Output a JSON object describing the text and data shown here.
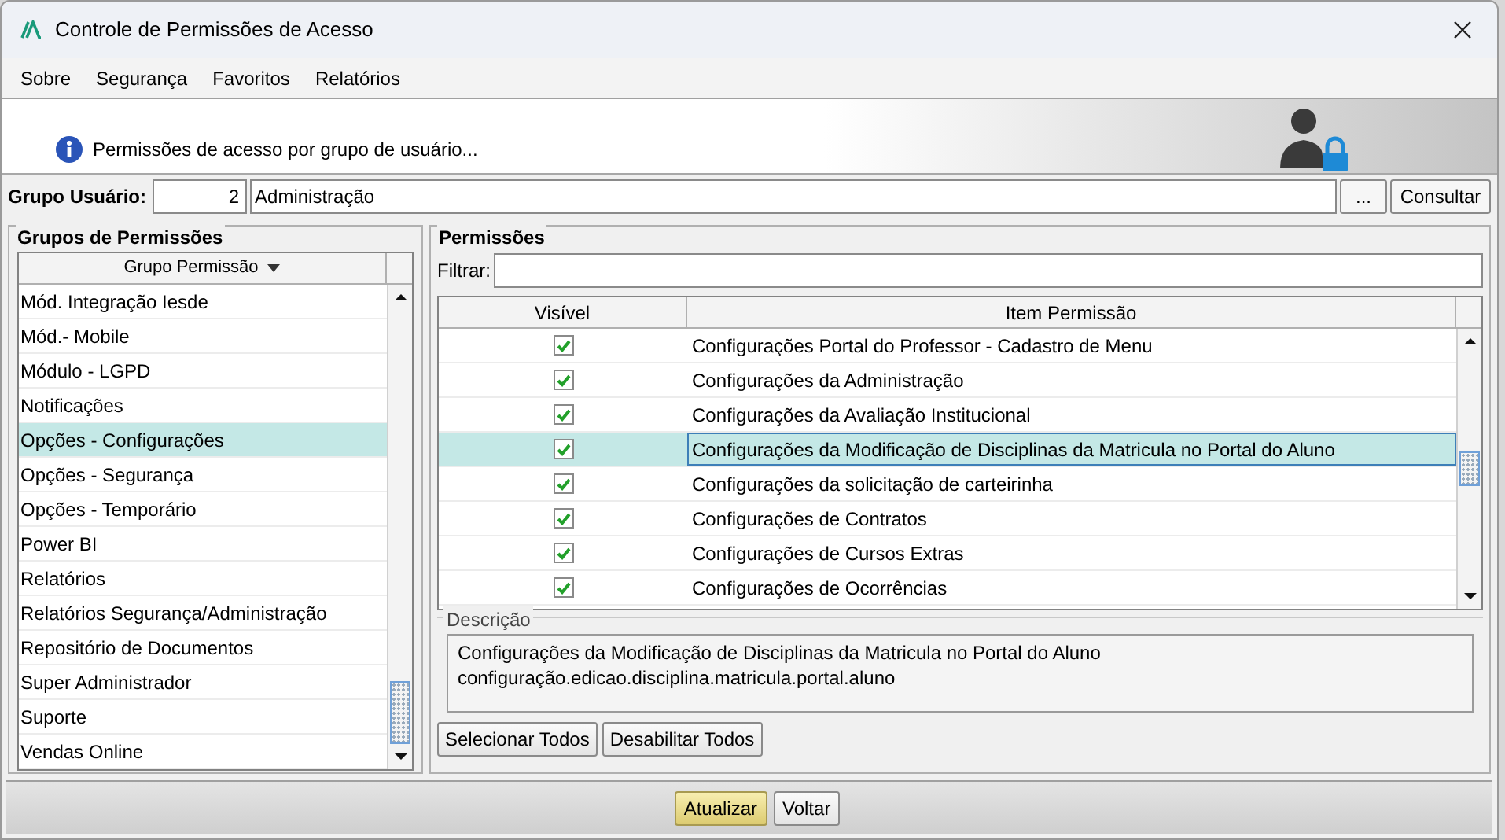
{
  "window": {
    "title": "Controle de Permissões de Acesso"
  },
  "menu": [
    {
      "label": "Sobre"
    },
    {
      "label": "Segurança"
    },
    {
      "label": "Favoritos"
    },
    {
      "label": "Relatórios"
    }
  ],
  "header": {
    "message": "Permissões de acesso por grupo de usuário..."
  },
  "user_group": {
    "label": "Grupo Usuário:",
    "code": "2",
    "name": "Administração",
    "browse_button": "...",
    "search_button": "Consultar"
  },
  "groups_panel": {
    "title": "Grupos de Permissões",
    "column": "Grupo Permissão",
    "items": [
      {
        "label": "Mód. Integração Iesde",
        "selected": false
      },
      {
        "label": "Mód.- Mobile",
        "selected": false
      },
      {
        "label": "Módulo - LGPD",
        "selected": false
      },
      {
        "label": "Notificações",
        "selected": false
      },
      {
        "label": "Opções - Configurações",
        "selected": true
      },
      {
        "label": "Opções - Segurança",
        "selected": false
      },
      {
        "label": "Opções - Temporário",
        "selected": false
      },
      {
        "label": "Power BI",
        "selected": false
      },
      {
        "label": "Relatórios",
        "selected": false
      },
      {
        "label": "Relatórios Segurança/Administração",
        "selected": false
      },
      {
        "label": "Repositório de Documentos",
        "selected": false
      },
      {
        "label": "Super Administrador",
        "selected": false
      },
      {
        "label": "Suporte",
        "selected": false
      },
      {
        "label": "Vendas Online",
        "selected": false
      }
    ]
  },
  "permissions_panel": {
    "title": "Permissões",
    "filter_label": "Filtrar:",
    "columns": [
      "Visível",
      "Item Permissão"
    ],
    "rows": [
      {
        "visible": true,
        "item": "Configurações Portal do Professor - Cadastro de Menu",
        "selected": false
      },
      {
        "visible": true,
        "item": "Configurações da Administração",
        "selected": false
      },
      {
        "visible": true,
        "item": "Configurações da Avaliação Institucional",
        "selected": false
      },
      {
        "visible": true,
        "item": "Configurações da Modificação de Disciplinas da Matricula no Portal do Aluno",
        "selected": true
      },
      {
        "visible": true,
        "item": "Configurações da solicitação de carteirinha",
        "selected": false
      },
      {
        "visible": true,
        "item": "Configurações de Contratos",
        "selected": false
      },
      {
        "visible": true,
        "item": "Configurações de Cursos Extras",
        "selected": false
      },
      {
        "visible": true,
        "item": "Configurações de Ocorrências",
        "selected": false
      }
    ],
    "description_title": "Descrição",
    "description_lines": [
      "Configurações da Modificação de Disciplinas da Matricula no Portal do Aluno",
      "configuração.edicao.disciplina.matricula.portal.aluno"
    ],
    "buttons": [
      "Selecionar Todos",
      "Desabilitar Todos"
    ]
  },
  "footer_buttons": [
    {
      "label": "Atualizar",
      "default": true
    },
    {
      "label": "Voltar",
      "default": false
    }
  ]
}
